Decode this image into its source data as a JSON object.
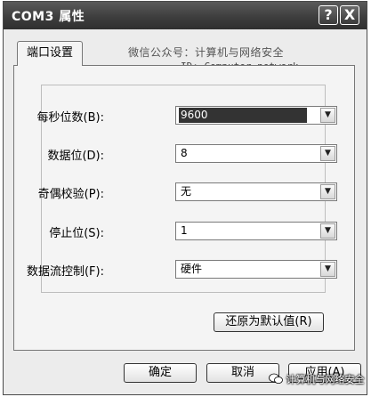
{
  "window": {
    "title": "COM3 属性",
    "help_label": "?",
    "close_label": "X"
  },
  "tab": {
    "label": "端口设置"
  },
  "watermark": {
    "line1": "微信公众号：计算机与网络安全",
    "line2": "ID: Computer-network"
  },
  "settings": [
    {
      "label": "每秒位数(B):",
      "value": "9600",
      "selected": true
    },
    {
      "label": "数据位(D):",
      "value": "8"
    },
    {
      "label": "奇偶校验(P):",
      "value": "无"
    },
    {
      "label": "停止位(S):",
      "value": "1"
    },
    {
      "label": "数据流控制(F):",
      "value": "硬件"
    }
  ],
  "buttons": {
    "restore": "还原为默认值(R)",
    "ok": "确定",
    "cancel": "取消",
    "apply": "应用(A)"
  },
  "brand": {
    "text": "计算机与网络安全"
  },
  "icons": {
    "dropdown": "chevron-down-icon",
    "brand_logo": "wechat-logo-icon"
  }
}
